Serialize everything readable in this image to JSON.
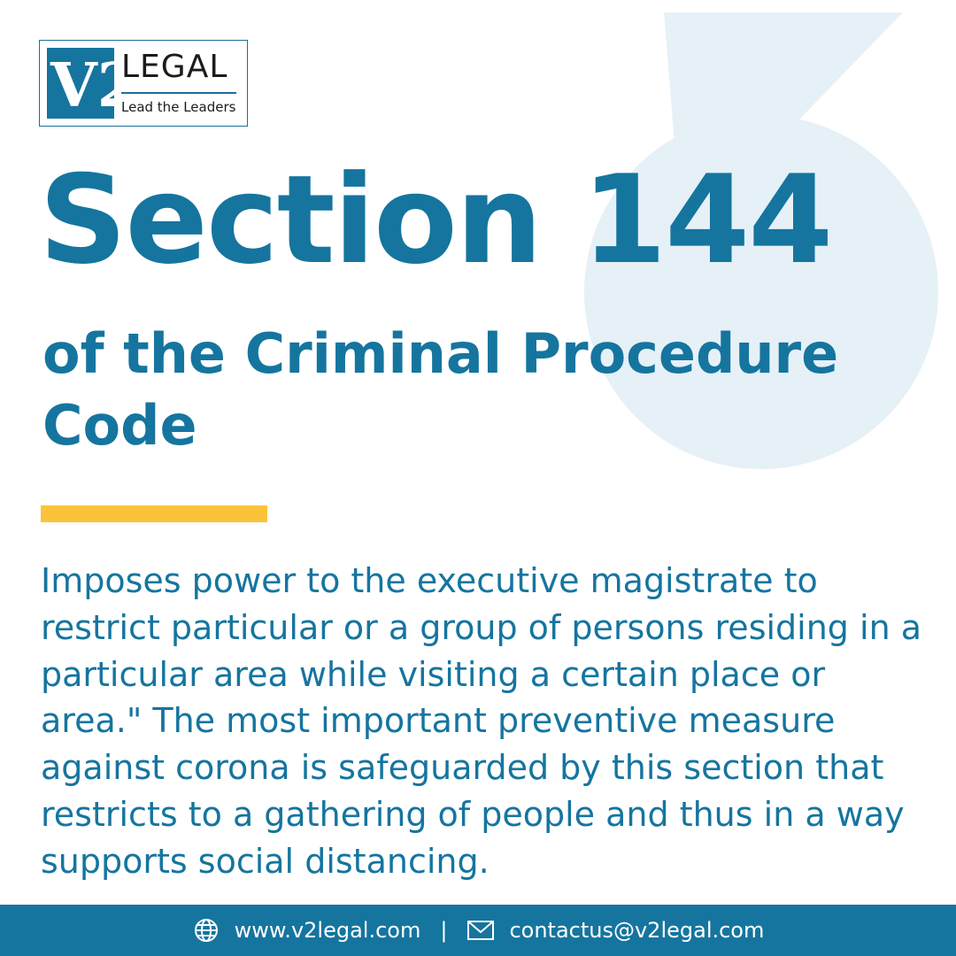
{
  "brand": {
    "logo_mark": "V2",
    "name": "LEGAL",
    "tagline": "Lead the Leaders"
  },
  "title": "Section 144",
  "subtitle": "of the Criminal Procedure Code",
  "body": "Imposes power to the executive magistrate to restrict particular or a group of persons residing in a particular area while visiting a certain place or area.\" The most important preventive measure against corona is safeguarded by this section that restricts to a gathering of people and thus in a way supports social distancing.",
  "footer": {
    "website": "www.v2legal.com",
    "separator": "|",
    "email": "contactus@v2legal.com",
    "website_icon": "globe-icon",
    "email_icon": "envelope-icon"
  },
  "colors": {
    "primary": "#15759f",
    "accent": "#fbc33a",
    "watermark": "#e6f0f7",
    "background": "#ffffff"
  }
}
